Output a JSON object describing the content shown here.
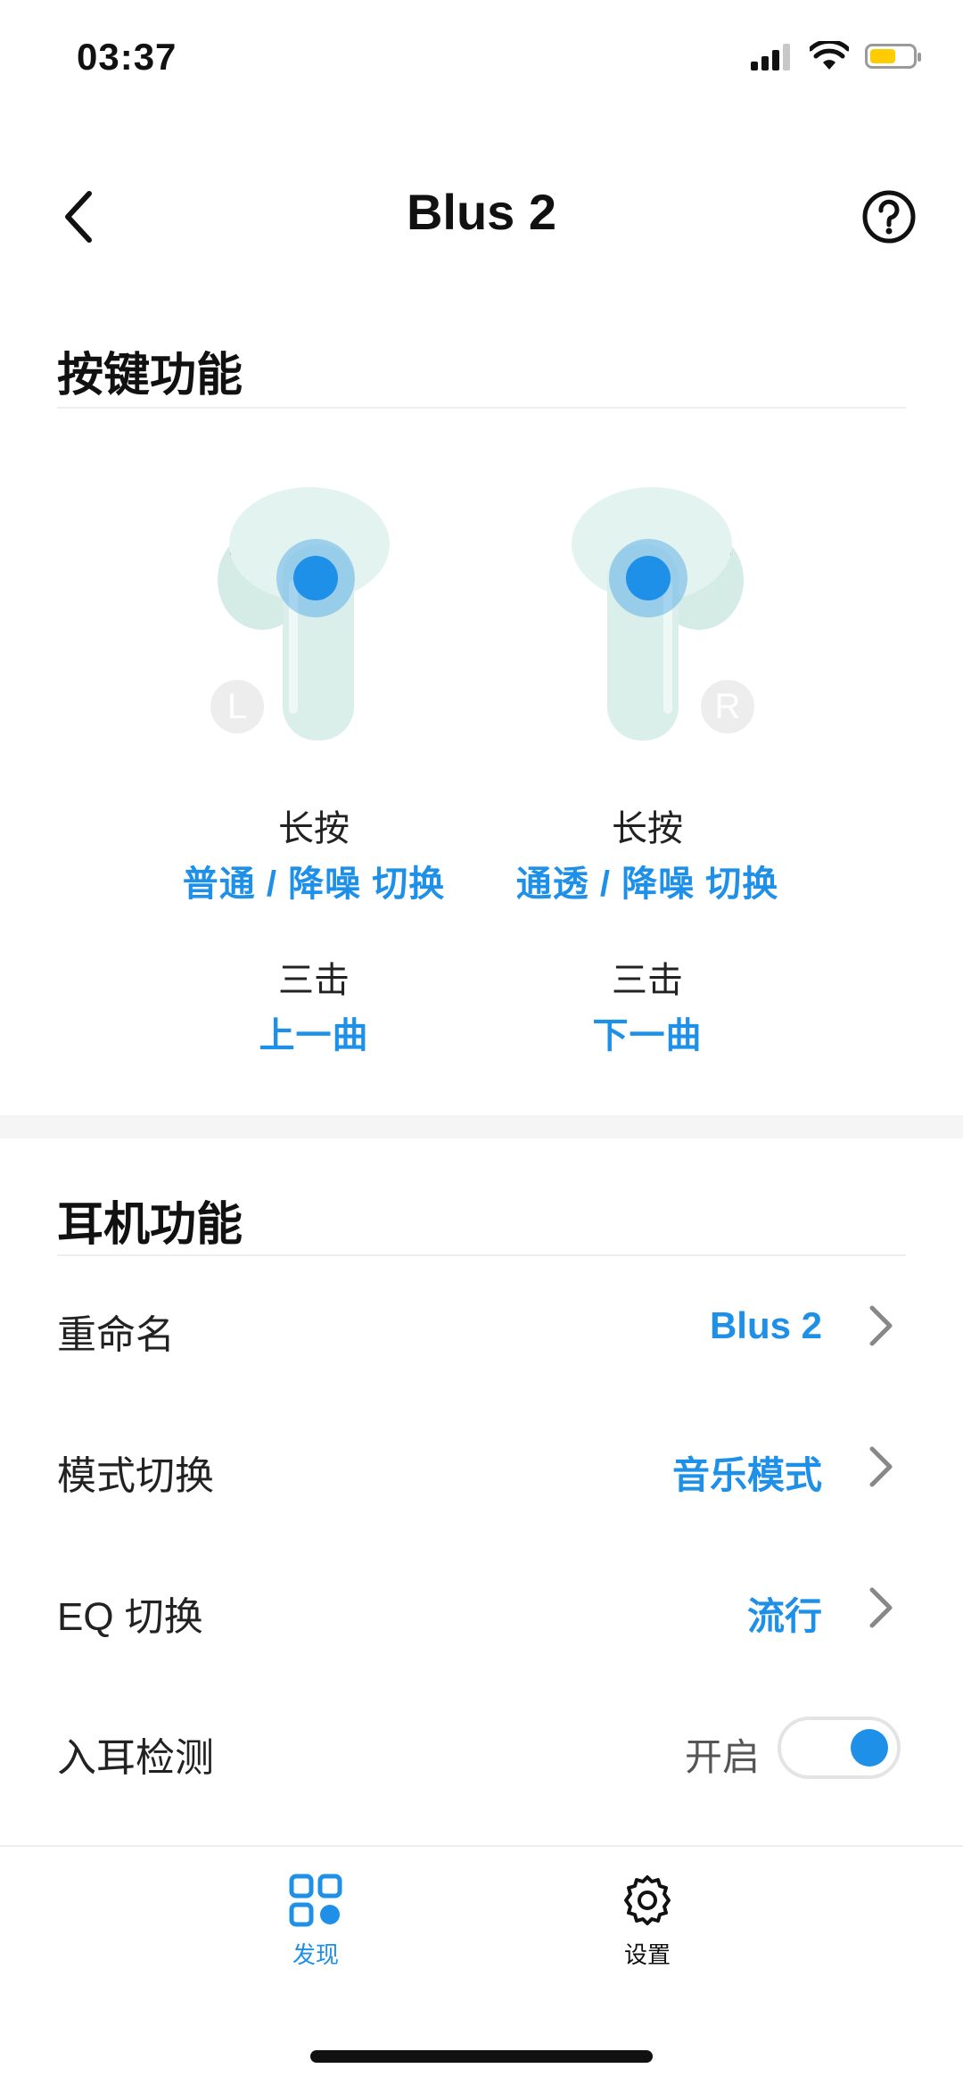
{
  "status_bar": {
    "time": "03:37",
    "icons": [
      "signal-icon",
      "wifi-icon",
      "battery-icon"
    ],
    "battery_color": "#ffcc00"
  },
  "header": {
    "title": "Blus 2",
    "back_icon": "back-chevron-icon",
    "help_icon": "help-icon"
  },
  "buttons_section": {
    "title": "按键功能",
    "left": {
      "side_badge": "L",
      "long_press_label": "长按",
      "long_press_value": "普通 / 降噪 切换",
      "triple_tap_label": "三击",
      "triple_tap_value": "上一曲"
    },
    "right": {
      "side_badge": "R",
      "long_press_label": "长按",
      "long_press_value": "通透 / 降噪 切换",
      "triple_tap_label": "三击",
      "triple_tap_value": "下一曲"
    }
  },
  "earphone_section": {
    "title": "耳机功能",
    "rows": [
      {
        "label": "重命名",
        "value": "Blus 2"
      },
      {
        "label": "模式切换",
        "value": "音乐模式"
      },
      {
        "label": "EQ 切换",
        "value": "流行"
      },
      {
        "label": "入耳检测",
        "value": "开启",
        "toggle_on": true
      }
    ]
  },
  "bottom_nav": {
    "items": [
      {
        "label": "发现",
        "icon": "discover-grid-icon",
        "active": true
      },
      {
        "label": "设置",
        "icon": "gear-icon",
        "active": false
      }
    ]
  },
  "colors": {
    "accent": "#1e90e8",
    "earbud_body": "#dff0ec"
  }
}
